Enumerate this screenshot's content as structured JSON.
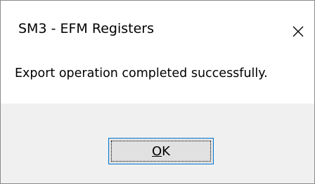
{
  "window": {
    "title": "SM3 - EFM Registers"
  },
  "message": {
    "text": "Export operation completed successfully."
  },
  "buttons": {
    "ok": {
      "mnemonic": "O",
      "rest": "K"
    }
  },
  "icons": {
    "close": "close-icon"
  },
  "colors": {
    "content_background": "#ffffff",
    "footer_background": "#f0f0f0",
    "button_face": "#e1e1e1",
    "button_focus_border": "#0078d7",
    "window_border": "#8a8a8a"
  }
}
